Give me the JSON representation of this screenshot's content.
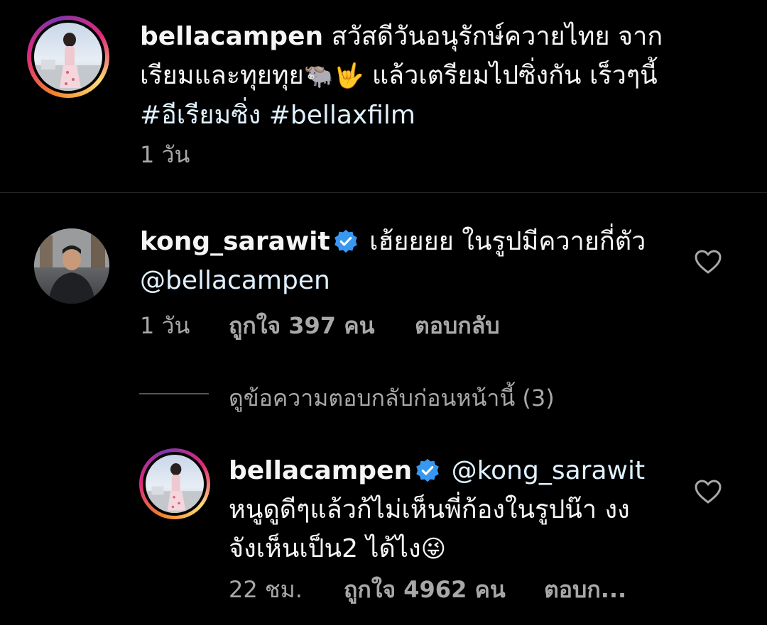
{
  "post": {
    "username": "bellacampen",
    "caption_line1": "สวัสดีวันอนุรักษ์ควายไทย จาก",
    "caption_line2_pre": "เรียมและทุยทุย",
    "caption_line2_emoji": "🐃🤟",
    "caption_line2_post": " แล้วเตรียมไปซิ่งกัน เร็วๆนี้",
    "hashtag1": "#อีเรียมซิ่ง",
    "hashtag2": "#bellaxfilm",
    "time": "1 วัน"
  },
  "comment": {
    "username": "kong_sarawit",
    "text_line1": "เฮ้ยยยย ในรูปมีควายกี่ตัว",
    "mention": "@bellacampen",
    "time": "1 วัน",
    "likes": "ถูกใจ 397 คน",
    "reply": "ตอบกลับ",
    "view_replies": "ดูข้อความตอบกลับก่อนหน้านี้ (3)"
  },
  "reply": {
    "username": "bellacampen",
    "mention": "@kong_sarawit",
    "text_line1": "หนูดูดีๆแล้วก้ไม่เห็นพี่ก้องในรูปน๊า งง",
    "text_line2": "จังเห็นเป็น2 ได้ไง",
    "emoji": "😜",
    "time": "22 ชม.",
    "likes": "ถูกใจ 4962 คน",
    "reply": "ตอบก..."
  },
  "icons": {
    "heart": "heart-outline-icon",
    "verified": "verified-badge-icon",
    "verified_color": "#3897f0"
  }
}
